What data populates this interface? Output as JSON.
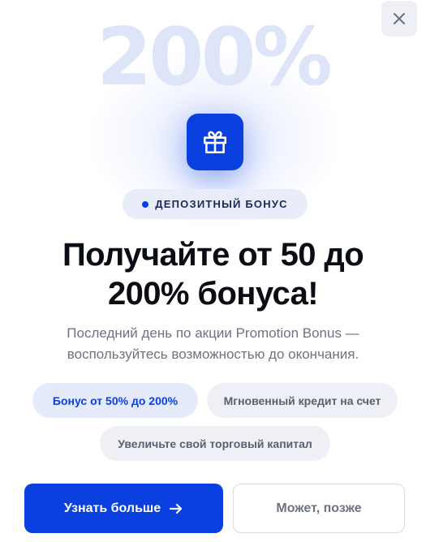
{
  "hero": {
    "big_number": "200%"
  },
  "close": {
    "icon": "close-icon"
  },
  "gift": {
    "icon": "gift-icon"
  },
  "badge": {
    "text": "ДЕПОЗИТНЫЙ БОНУС"
  },
  "title": {
    "line1": "Получайте от 50 до",
    "line2": "200% бонуса!"
  },
  "subtitle": {
    "line1": "Последний день по акции Promotion Bonus —",
    "line2": "воспользуйтесь возможностью до окончания."
  },
  "chips": [
    "Бонус от 50% до 200%",
    "Мгновенный кредит на счет",
    "Увеличьте свой торговый капитал"
  ],
  "actions": {
    "primary_label": "Узнать больше",
    "secondary_label": "Может, позже"
  },
  "colors": {
    "accent": "#0a3fe0",
    "text_dark": "#0b0d14",
    "text_muted": "#6d7382",
    "chip_bg": "#eef0f6"
  }
}
